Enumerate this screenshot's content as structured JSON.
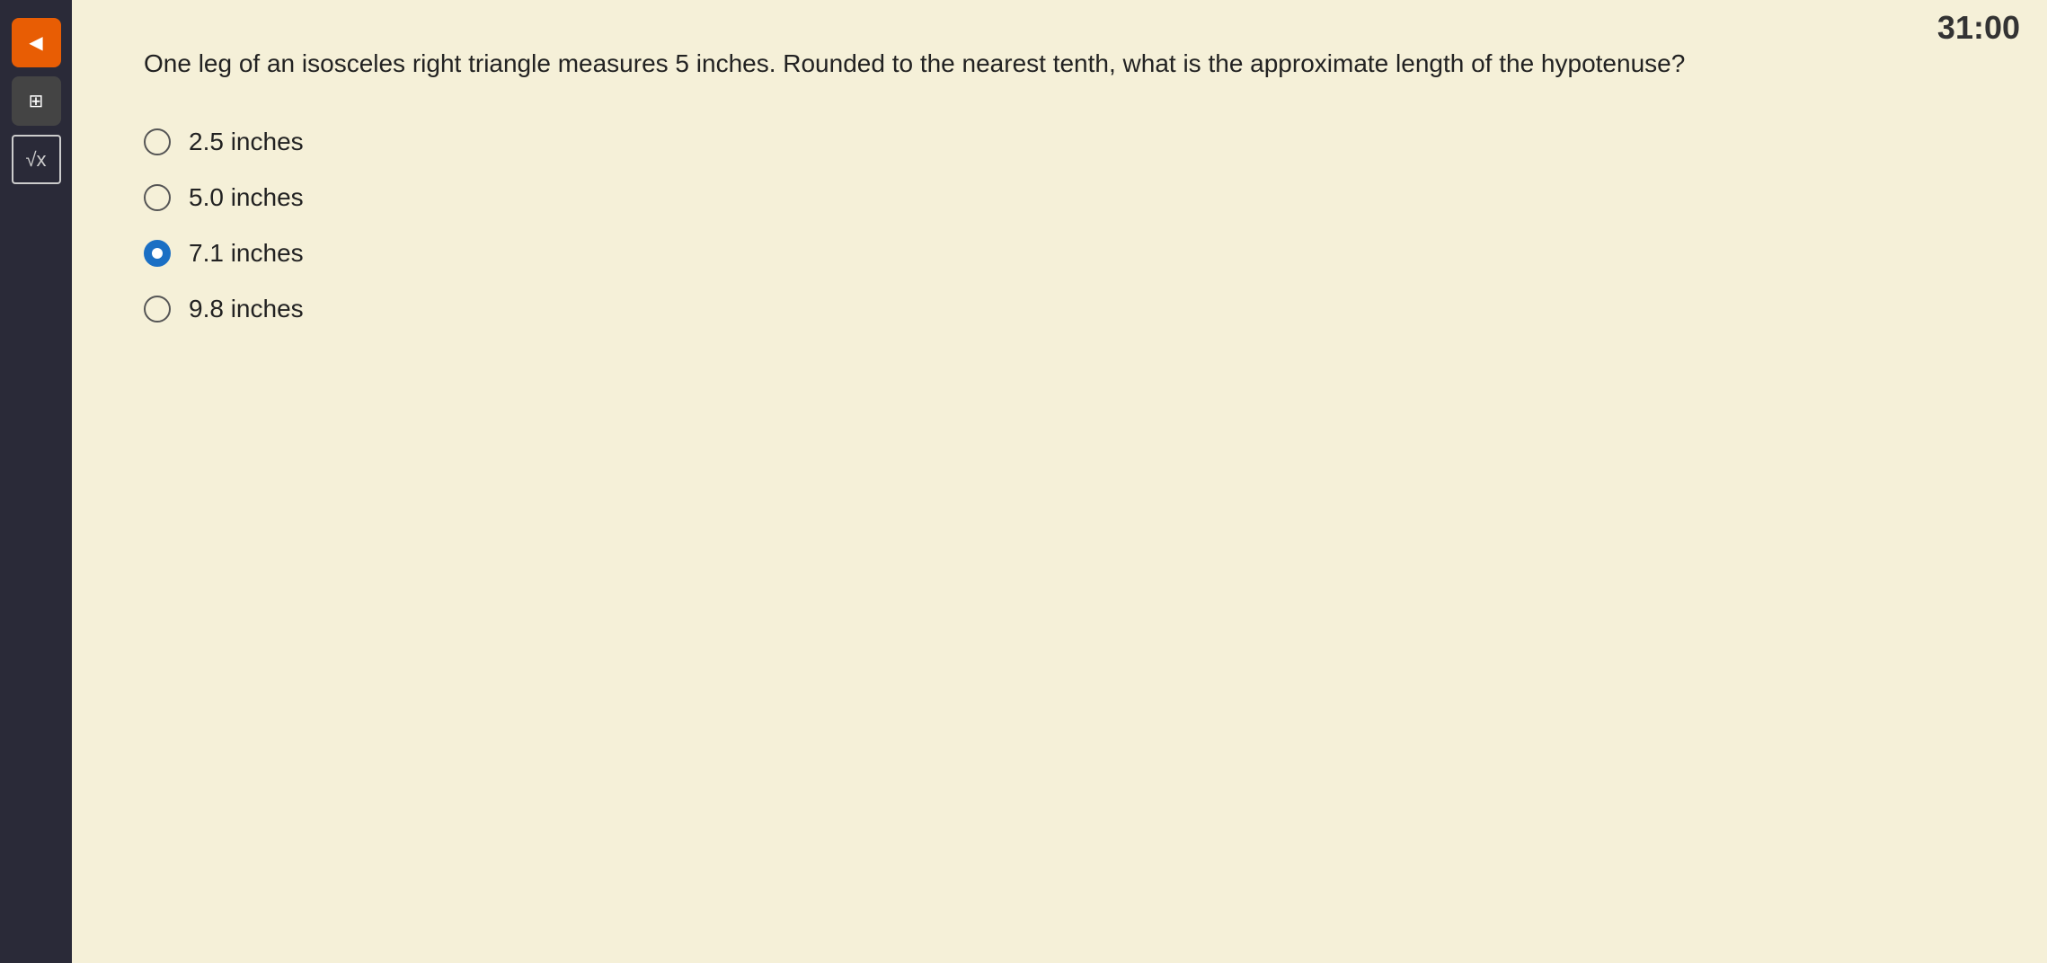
{
  "timer": "31:00",
  "question": {
    "text": "One leg of an isosceles right triangle measures 5 inches. Rounded to the nearest tenth, what is the approximate length of the hypotenuse?"
  },
  "options": [
    {
      "id": "opt1",
      "label": "2.5 inches",
      "selected": false
    },
    {
      "id": "opt2",
      "label": "5.0 inches",
      "selected": false
    },
    {
      "id": "opt3",
      "label": "7.1 inches",
      "selected": true
    },
    {
      "id": "opt4",
      "label": "9.8 inches",
      "selected": false
    }
  ],
  "sidebar": {
    "buttons": [
      {
        "id": "btn1",
        "icon": "◀",
        "style": "orange"
      },
      {
        "id": "btn2",
        "icon": "⊞",
        "style": "dark"
      },
      {
        "id": "btn3",
        "icon": "√x",
        "style": "sqrt"
      }
    ]
  }
}
